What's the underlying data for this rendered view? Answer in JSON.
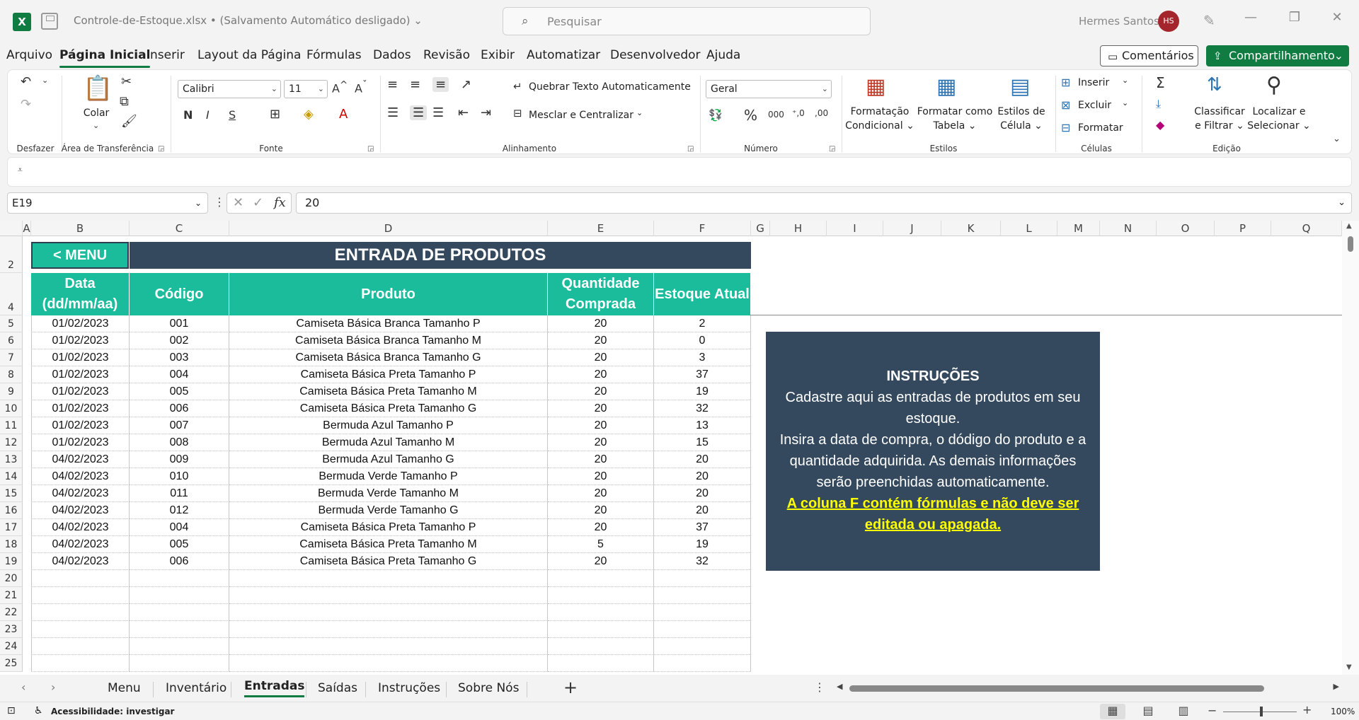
{
  "titlebar": {
    "app_icon": "X",
    "doc_title": "Controle-de-Estoque.xlsx •  (Salvamento Automático desligado) ⌄",
    "search_placeholder": "Pesquisar",
    "user_name": "Hermes Santos",
    "user_initials": "HS"
  },
  "menu": {
    "tabs": [
      "Arquivo",
      "Página Inicial",
      "Inserir",
      "Layout da Página",
      "Fórmulas",
      "Dados",
      "Revisão",
      "Exibir",
      "Automatizar",
      "Desenvolvedor",
      "Ajuda"
    ],
    "active": "Página Inicial",
    "comments_label": "Comentários",
    "share_label": "Compartilhamento"
  },
  "ribbon": {
    "groups": {
      "undo": "Desfazer",
      "clipboard": "Área de Transferência",
      "font": "Fonte",
      "alignment": "Alinhamento",
      "number": "Número",
      "styles": "Estilos",
      "cells": "Células",
      "editing": "Edição"
    },
    "paste_label": "Colar",
    "font_name": "Calibri",
    "font_size": "11",
    "bold": "N",
    "italic": "I",
    "underline": "S",
    "wrap_text": "Quebrar Texto Automaticamente",
    "merge_center": "Mesclar e Centralizar",
    "number_format": "Geral",
    "cond_format": [
      "Formatação",
      "Condicional ⌄"
    ],
    "format_table": [
      "Formatar como",
      "Tabela ⌄"
    ],
    "cell_styles": [
      "Estilos de",
      "Célula ⌄"
    ],
    "insert": "Inserir",
    "delete": "Excluir",
    "format": "Formatar",
    "sort_filter": [
      "Classificar",
      "e Filtrar ⌄"
    ],
    "find_select": [
      "Localizar e",
      "Selecionar ⌄"
    ]
  },
  "formula_bar": {
    "name_box": "E19",
    "value": "20"
  },
  "sheet": {
    "columns": [
      "A",
      "B",
      "C",
      "D",
      "E",
      "F",
      "G",
      "H",
      "I",
      "J",
      "K",
      "L",
      "M",
      "N",
      "O",
      "P",
      "Q"
    ],
    "menu_button": "< MENU",
    "banner": "ENTRADA DE PRODUTOS",
    "headers": [
      "Data (dd/mm/aa)",
      "Código",
      "Produto",
      "Quantidade Comprada",
      "Estoque Atual"
    ],
    "row_numbers": [
      "2",
      "4",
      "5",
      "6",
      "7",
      "8",
      "9",
      "10",
      "11",
      "12",
      "13",
      "14",
      "15",
      "16",
      "17",
      "18",
      "19",
      "20",
      "21",
      "22",
      "23",
      "24",
      "25"
    ],
    "rows": [
      [
        "01/02/2023",
        "001",
        "Camiseta Básica Branca Tamanho P",
        "20",
        "2"
      ],
      [
        "01/02/2023",
        "002",
        "Camiseta Básica Branca Tamanho M",
        "20",
        "0"
      ],
      [
        "01/02/2023",
        "003",
        "Camiseta Básica Branca Tamanho G",
        "20",
        "3"
      ],
      [
        "01/02/2023",
        "004",
        "Camiseta Básica Preta Tamanho P",
        "20",
        "37"
      ],
      [
        "01/02/2023",
        "005",
        "Camiseta Básica Preta Tamanho M",
        "20",
        "19"
      ],
      [
        "01/02/2023",
        "006",
        "Camiseta Básica Preta Tamanho G",
        "20",
        "32"
      ],
      [
        "01/02/2023",
        "007",
        "Bermuda Azul Tamanho P",
        "20",
        "13"
      ],
      [
        "01/02/2023",
        "008",
        "Bermuda Azul Tamanho M",
        "20",
        "15"
      ],
      [
        "04/02/2023",
        "009",
        "Bermuda Azul Tamanho G",
        "20",
        "20"
      ],
      [
        "04/02/2023",
        "010",
        "Bermuda Verde Tamanho P",
        "20",
        "20"
      ],
      [
        "04/02/2023",
        "011",
        "Bermuda Verde Tamanho M",
        "20",
        "20"
      ],
      [
        "04/02/2023",
        "012",
        "Bermuda Verde Tamanho G",
        "20",
        "20"
      ],
      [
        "04/02/2023",
        "004",
        "Camiseta Básica Preta Tamanho P",
        "20",
        "37"
      ],
      [
        "04/02/2023",
        "005",
        "Camiseta Básica Preta Tamanho M",
        "5",
        "19"
      ],
      [
        "04/02/2023",
        "006",
        "Camiseta Básica Preta Tamanho G",
        "20",
        "32"
      ]
    ],
    "instructions": {
      "title": "INSTRUÇÕES",
      "line1": "Cadastre aqui as entradas de produtos em seu estoque.",
      "line2": "Insira a data de compra, o dódigo do produto e a quantidade adquirida. As demais informações serão preenchidas automaticamente.",
      "warning": "A coluna F contém fórmulas e não deve ser editada ou apagada."
    }
  },
  "sheet_tabs": {
    "tabs": [
      "Menu",
      "Inventário",
      "Entradas",
      "Saídas",
      "Instruções",
      "Sobre Nós"
    ],
    "active": "Entradas",
    "add": "+"
  },
  "status": {
    "accessibility": "Acessibilidade: investigar",
    "zoom": "100%"
  },
  "colors": {
    "excel_green": "#107c41",
    "teal": "#1abc9c",
    "navy": "#34495e",
    "warning_yellow": "#ffff00"
  }
}
